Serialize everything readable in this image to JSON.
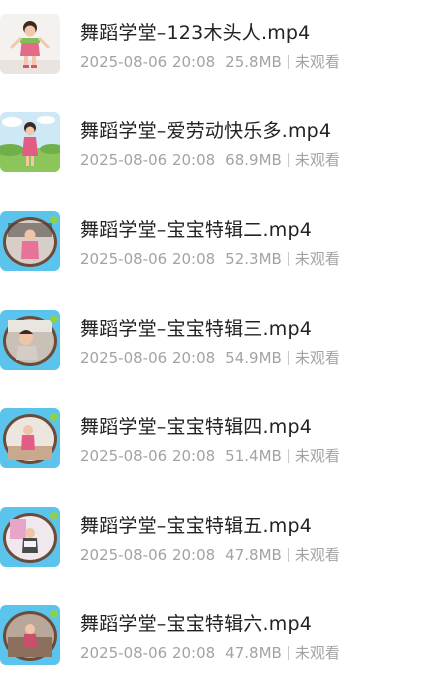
{
  "files": [
    {
      "name": "舞蹈学堂–123木头人.mp4",
      "date": "2025-08-06 20:08",
      "size": "25.8MB",
      "status": "未观看",
      "thumb_icon": "girl-in-pink-thumbnail"
    },
    {
      "name": "舞蹈学堂–爱劳动快乐多.mp4",
      "date": "2025-08-06 20:08",
      "size": "68.9MB",
      "status": "未观看",
      "thumb_icon": "girl-in-meadow-thumbnail"
    },
    {
      "name": "舞蹈学堂–宝宝特辑二.mp4",
      "date": "2025-08-06 20:08",
      "size": "52.3MB",
      "status": "未观看",
      "thumb_icon": "child-in-frame-thumbnail"
    },
    {
      "name": "舞蹈学堂–宝宝特辑三.mp4",
      "date": "2025-08-06 20:08",
      "size": "54.9MB",
      "status": "未观看",
      "thumb_icon": "child-in-frame-thumbnail"
    },
    {
      "name": "舞蹈学堂–宝宝特辑四.mp4",
      "date": "2025-08-06 20:08",
      "size": "51.4MB",
      "status": "未观看",
      "thumb_icon": "child-in-frame-thumbnail"
    },
    {
      "name": "舞蹈学堂–宝宝特辑五.mp4",
      "date": "2025-08-06 20:08",
      "size": "47.8MB",
      "status": "未观看",
      "thumb_icon": "child-in-frame-thumbnail"
    },
    {
      "name": "舞蹈学堂–宝宝特辑六.mp4",
      "date": "2025-08-06 20:08",
      "size": "47.8MB",
      "status": "未观看",
      "thumb_icon": "child-in-frame-thumbnail"
    }
  ]
}
